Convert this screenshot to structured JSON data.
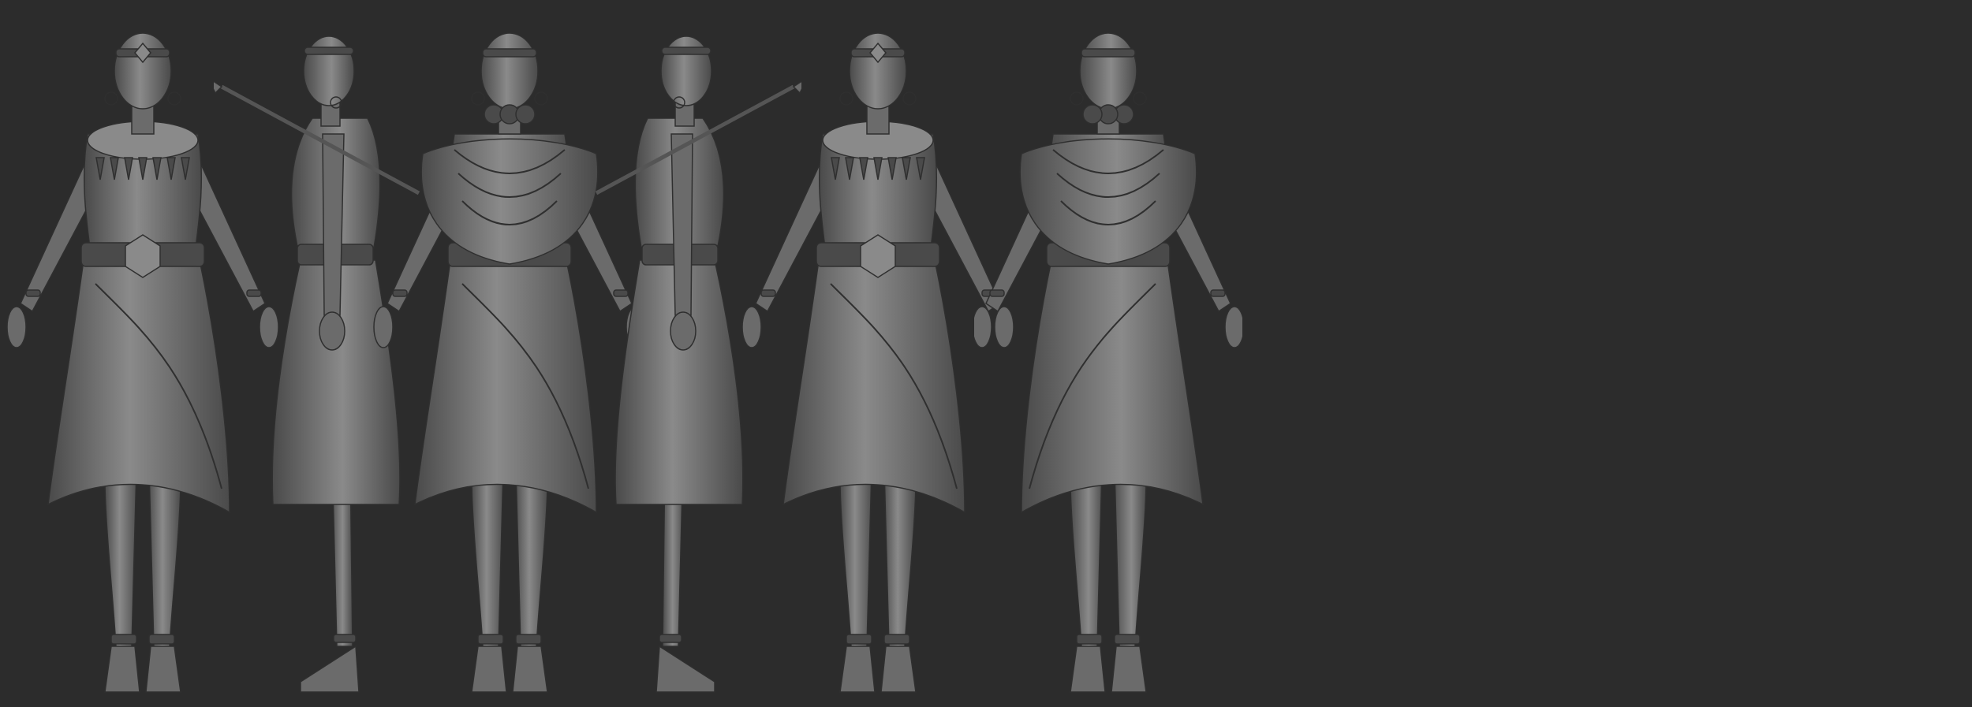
{
  "scene": {
    "background": "#2c2c2c",
    "base_color": "#6b6b6b",
    "shade_color": "#4a4a4a",
    "highlight_color": "#8a8a8a",
    "edge_color": "#2f2f2f",
    "views": [
      {
        "key": "front",
        "kind": "front",
        "facing": 1,
        "icon": "turnaround-front"
      },
      {
        "key": "side-left",
        "kind": "side",
        "facing": -1,
        "icon": "turnaround-side-left"
      },
      {
        "key": "back",
        "kind": "back",
        "facing": 1,
        "icon": "turnaround-back"
      },
      {
        "key": "side-right",
        "kind": "side",
        "facing": 1,
        "icon": "turnaround-side-right"
      },
      {
        "key": "three-quarter-front",
        "kind": "front",
        "facing": 1,
        "icon": "turnaround-three-quarter-front"
      },
      {
        "key": "three-quarter-back",
        "kind": "back",
        "facing": -1,
        "icon": "turnaround-three-quarter-back"
      }
    ]
  }
}
